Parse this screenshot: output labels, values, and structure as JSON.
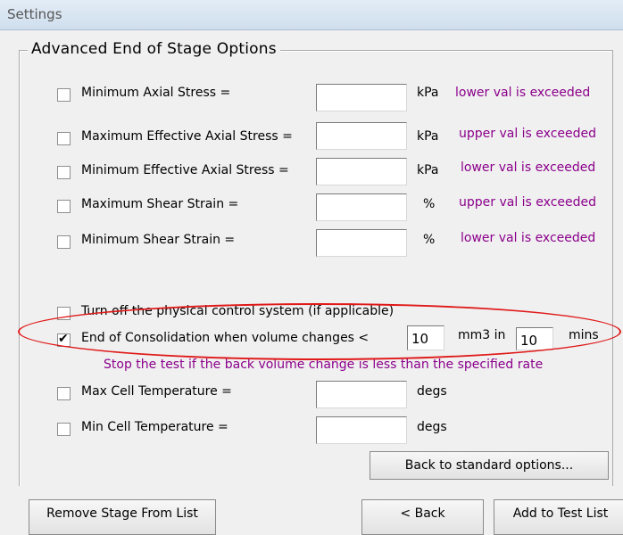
{
  "window": {
    "title": "Settings"
  },
  "group": {
    "title": "Advanced End of Stage Options"
  },
  "criteria": [
    {
      "label": "Minimum Axial Stress =",
      "value": "",
      "unit": "kPa",
      "note": "lower val is exceeded",
      "checked": false
    },
    {
      "label": "Maximum Effective Axial Stress =",
      "value": "",
      "unit": "kPa",
      "note": "upper val is exceeded",
      "checked": false
    },
    {
      "label": "Minimum Effective Axial Stress =",
      "value": "",
      "unit": "kPa",
      "note": "lower val is exceeded",
      "checked": false
    },
    {
      "label": "Maximum Shear Strain =",
      "value": "",
      "unit": "%",
      "note": "upper val is exceeded",
      "checked": false
    },
    {
      "label": "Minimum Shear Strain =",
      "value": "",
      "unit": "%",
      "note": "lower val is exceeded",
      "checked": false
    }
  ],
  "physical_control": {
    "label": "Turn off the physical control system (if applicable)",
    "checked": false
  },
  "consolidation": {
    "label": "End of Consolidation when volume changes <",
    "checked": true,
    "volume_value": "10",
    "volume_unit": "mm3 in",
    "time_value": "10",
    "time_unit": "mins",
    "note": "Stop the test if the back volume change is less than the specified rate"
  },
  "temperature": [
    {
      "label": "Max Cell Temperature =",
      "value": "",
      "unit": "degs",
      "checked": false
    },
    {
      "label": "Min Cell Temperature =",
      "value": "",
      "unit": "degs",
      "checked": false
    }
  ],
  "buttons": {
    "back_to_standard": "Back to standard options...",
    "remove_stage": "Remove Stage From List",
    "back": "< Back",
    "add_to_test_list": "Add to Test List"
  },
  "colors": {
    "note": "#8b008b",
    "highlight": "#e01919"
  }
}
